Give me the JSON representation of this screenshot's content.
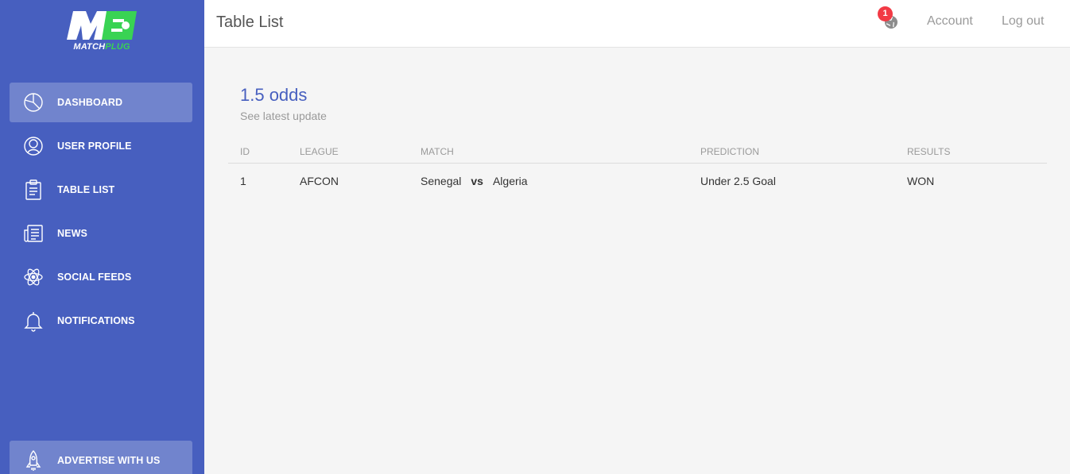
{
  "brand": {
    "logo_text_white": "MATCH",
    "logo_text_green": "PLUG",
    "logo_mark": "M"
  },
  "sidebar": {
    "items": [
      {
        "label": "DASHBOARD",
        "icon": "pie-chart-icon",
        "active": true
      },
      {
        "label": "USER PROFILE",
        "icon": "user-icon",
        "active": false
      },
      {
        "label": "TABLE LIST",
        "icon": "clipboard-icon",
        "active": false
      },
      {
        "label": "NEWS",
        "icon": "news-icon",
        "active": false
      },
      {
        "label": "SOCIAL FEEDS",
        "icon": "atom-icon",
        "active": false
      },
      {
        "label": "NOTIFICATIONS",
        "icon": "bell-icon",
        "active": false
      }
    ],
    "advertise": {
      "label": "ADVERTISE WITH US",
      "icon": "rocket-icon"
    }
  },
  "header": {
    "title": "Table List",
    "notification_count": "1",
    "account": "Account",
    "logout": "Log out"
  },
  "card": {
    "title": "1.5 odds",
    "subtitle": "See latest update"
  },
  "table": {
    "columns": [
      "ID",
      "LEAGUE",
      "MATCH",
      "PREDICTION",
      "RESULTS"
    ],
    "rows": [
      {
        "id": "1",
        "league": "AFCON",
        "home": "Senegal",
        "vs": "vs",
        "away": "Algeria",
        "prediction": "Under 2.5 Goal",
        "result": "WON"
      }
    ]
  },
  "colors": {
    "sidebar": "#475fbf",
    "accent": "#475fbf",
    "logo_green": "#39d353",
    "badge": "#f23a45"
  }
}
